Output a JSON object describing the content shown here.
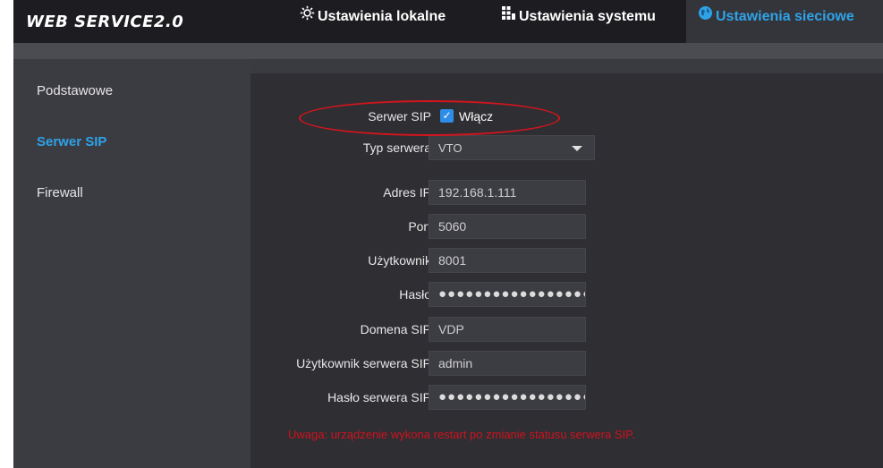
{
  "header": {
    "logo": "WEB SERVICE2.0",
    "tabs": [
      {
        "label": "Ustawienia lokalne",
        "icon": "gear-icon"
      },
      {
        "label": "Ustawienia systemu",
        "icon": "grid-icon"
      },
      {
        "label": "Ustawienia sieciowe",
        "icon": "globe-icon",
        "active": true
      }
    ]
  },
  "sidebar": {
    "items": [
      {
        "label": "Podstawowe"
      },
      {
        "label": "Serwer SIP",
        "active": true
      },
      {
        "label": "Firewall"
      }
    ]
  },
  "form": {
    "sip_server": {
      "label": "Serwer SIP",
      "checked": true,
      "checkbox_label": "Włącz"
    },
    "server_type": {
      "label": "Typ serwera",
      "value": "VTO"
    },
    "ip_address": {
      "label": "Adres IP",
      "value": "192.168.1.111"
    },
    "port": {
      "label": "Port",
      "value": "5060"
    },
    "user": {
      "label": "Użytkownik",
      "value": "8001"
    },
    "password": {
      "label": "Hasło",
      "value": "●●●●●●●●●●●●●●●●●●"
    },
    "sip_domain": {
      "label": "Domena SIP",
      "value": "VDP"
    },
    "server_user": {
      "label": "Użytkownik serwera SIP",
      "value": "admin"
    },
    "server_password": {
      "label": "Hasło serwera SIP",
      "value": "●●●●●●●●●●●●●●●●●●"
    }
  },
  "note": "Uwaga: urządzenie wykona restart po zmianie statusu serwera SIP.",
  "colors": {
    "accent": "#2ea3e8",
    "warning": "#d0121d",
    "annotation": "#d3151d"
  }
}
